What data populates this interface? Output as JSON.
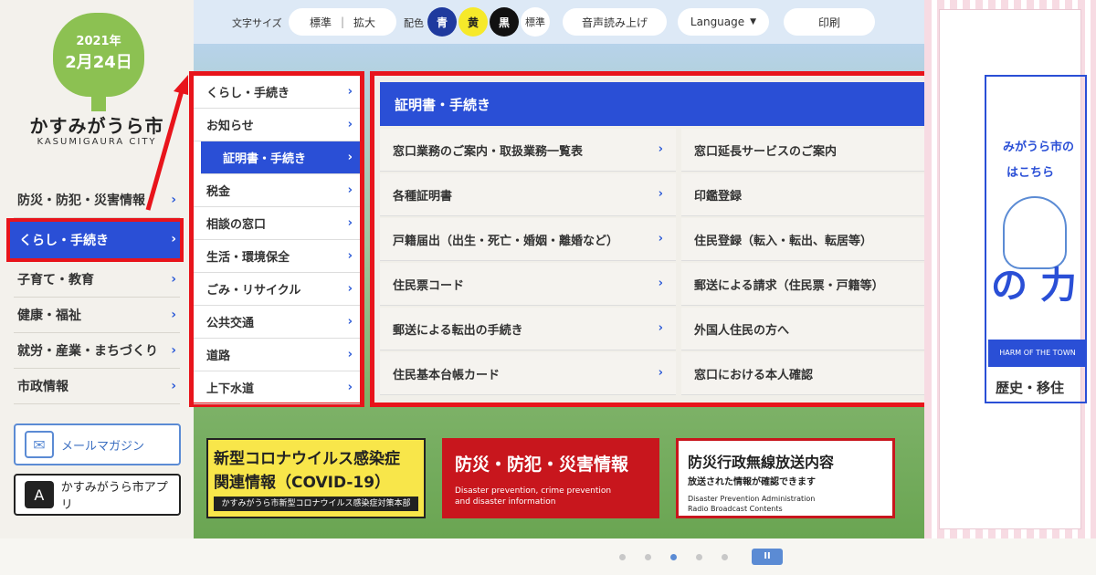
{
  "logo": {
    "year": "2021年",
    "date": "2月24日",
    "city_name": "かすみがうら市",
    "city_roman": "KASUMIGAURA CITY"
  },
  "sidebar": {
    "items": [
      {
        "label": "防災・防犯・災害情報"
      },
      {
        "label": "くらし・手続き"
      },
      {
        "label": "子育て・教育"
      },
      {
        "label": "健康・福祉"
      },
      {
        "label": "就労・産業・まちづくり"
      },
      {
        "label": "市政情報"
      }
    ],
    "mail_label": "メールマガジン",
    "app_label": "かすみがうら市アプリ"
  },
  "toolbar": {
    "font_size_label": "文字サイズ",
    "font_standard": "標準",
    "font_divider": "|",
    "font_large": "拡大",
    "color_label": "配色",
    "color_blue": "青",
    "color_yellow": "黄",
    "color_black": "黒",
    "color_standard": "標準",
    "tts": "音声読み上げ",
    "language": "Language",
    "print": "印刷",
    "colors": {
      "blue": "#1f3a9e",
      "yellow": "#f6e92a",
      "black": "#111111"
    }
  },
  "subnav": {
    "items": [
      {
        "label": "くらし・手続き"
      },
      {
        "label": "お知らせ"
      },
      {
        "label": "証明書・手続き"
      },
      {
        "label": "税金"
      },
      {
        "label": "相談の窓口"
      },
      {
        "label": "生活・環境保全"
      },
      {
        "label": "ごみ・リサイクル"
      },
      {
        "label": "公共交通"
      },
      {
        "label": "道路"
      },
      {
        "label": "上下水道"
      }
    ]
  },
  "mega": {
    "title": "証明書・手続き",
    "items": [
      {
        "label": "窓口業務のご案内・取扱業務一覧表"
      },
      {
        "label": "窓口延長サービスのご案内"
      },
      {
        "label": "各種証明書"
      },
      {
        "label": "印鑑登録"
      },
      {
        "label": "戸籍届出（出生・死亡・婚姻・離婚など）"
      },
      {
        "label": "住民登録（転入・転出、転居等）"
      },
      {
        "label": "住民票コード"
      },
      {
        "label": "郵送による請求（住民票・戸籍等）"
      },
      {
        "label": "郵送による転出の手続き"
      },
      {
        "label": "外国人住民の方へ"
      },
      {
        "label": "住民基本台帳カード"
      },
      {
        "label": "窓口における本人確認"
      }
    ]
  },
  "banners": {
    "covid": {
      "line1": "新型コロナウイルス感染症",
      "line2": "関連情報（COVID-19）",
      "line3": "かすみがうら市新型コロナウイルス感染症対策本部"
    },
    "disaster": {
      "title": "防災・防犯・災害情報",
      "sub1": "Disaster prevention, crime prevention",
      "sub2": "and disaster information"
    },
    "radio": {
      "title": "防災行政無線放送内容",
      "sub": "放送された情報が確認できます",
      "en1": "Disaster Prevention Administration",
      "en2": "Radio Broadcast Contents"
    }
  },
  "ad": {
    "line1": "みがうら市の",
    "line2": "はこちら",
    "big": "の 力",
    "band": "HARM OF THE TOWN",
    "bottom": "歴史・移住"
  },
  "carousel": {
    "pause": "II"
  }
}
